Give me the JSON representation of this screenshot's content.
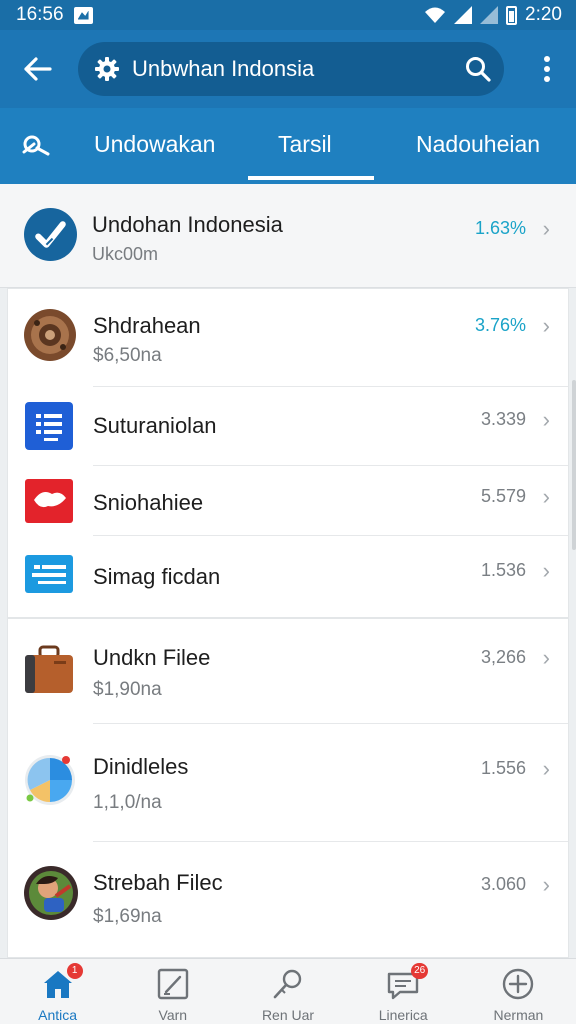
{
  "status_bar": {
    "time_left": "16:56",
    "time_right": "2:20"
  },
  "app_bar": {
    "title": "Unbwhan Indonsia",
    "icons": [
      "back-arrow-icon",
      "gear-icon",
      "search-icon",
      "more-vert-icon"
    ]
  },
  "tabs": [
    {
      "label": "Undowakan"
    },
    {
      "label": "Tarsil"
    },
    {
      "label": "Nadouheian"
    }
  ],
  "header_item": {
    "title": "Undohan Indonesia",
    "subtitle": "Ukc00m",
    "value": "1.63%"
  },
  "list": [
    {
      "title": "Shdrahean",
      "subtitle": "$6,50na",
      "value": "3.76%",
      "accent": true
    },
    {
      "title": "Suturaniolan",
      "subtitle": "",
      "value": "3.339"
    },
    {
      "title": "Sniohahiee",
      "subtitle": "",
      "value": "5.579"
    },
    {
      "title": "Simag ficdan",
      "subtitle": "",
      "value": "1.536"
    },
    {
      "title": "Undkn Filee",
      "subtitle": "$1,90na",
      "value": "3,266"
    },
    {
      "title": "Dinidleles",
      "subtitle": "1,1,0/na",
      "value": "1.556"
    },
    {
      "title": "Strebah Filec",
      "subtitle": "$1,69na",
      "value": "3.060"
    }
  ],
  "bottom_nav": [
    {
      "label": "Antica",
      "badge": "1",
      "active": true
    },
    {
      "label": "Varn",
      "badge": ""
    },
    {
      "label": "Ren Uar",
      "badge": ""
    },
    {
      "label": "Linerica",
      "badge": "26"
    },
    {
      "label": "Nerman",
      "badge": ""
    }
  ],
  "colors": {
    "primary": "#1d76b5",
    "tab_bar": "#1f80c0",
    "accent": "#1aa3c8"
  }
}
